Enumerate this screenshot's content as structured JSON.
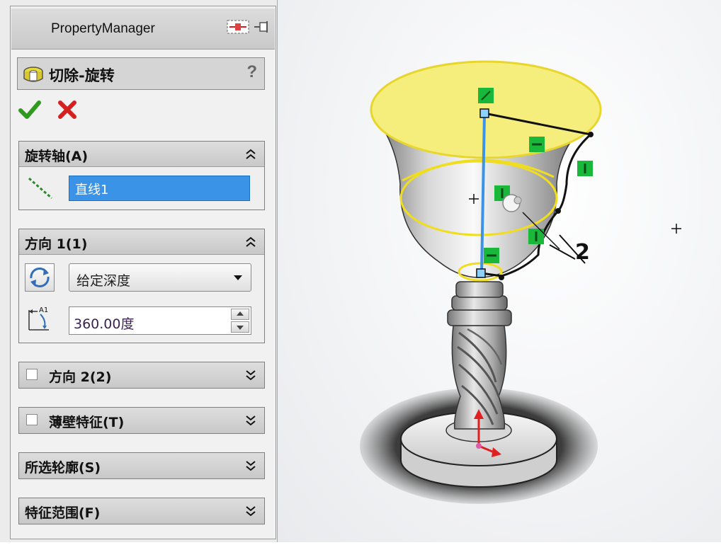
{
  "panel": {
    "title": "PropertyManager",
    "feature_title": "切除-旋转",
    "help_label": "?"
  },
  "groups": {
    "axis": {
      "title": "旋转轴(A)",
      "value": "直线1"
    },
    "direction1": {
      "title": "方向 1(1)",
      "type_value": "给定深度",
      "angle_value": "360.00度",
      "angle_icon_label": "A1"
    },
    "direction2": {
      "title": "方向 2(2)"
    },
    "thin": {
      "title": "薄壁特征(T)"
    },
    "contours": {
      "title": "所选轮廓(S)"
    },
    "scope": {
      "title": "特征范围(F)"
    }
  },
  "viewport": {
    "dimension_label": "2"
  },
  "colors": {
    "ok_green": "#2f9a1e",
    "cancel_red": "#d62020",
    "selection_blue": "#3a93e6",
    "sketch_yellow": "#f5ee7d",
    "handle_green": "#19b83a"
  },
  "icons": {
    "feature": "revolve-cut-icon",
    "ok": "checkmark-icon",
    "cancel": "close-icon",
    "axis": "axis-line-icon",
    "direction": "reverse-direction-icon",
    "angle": "angle-icon",
    "collapse": "double-chevron-up-icon",
    "expand": "double-chevron-down-icon"
  }
}
